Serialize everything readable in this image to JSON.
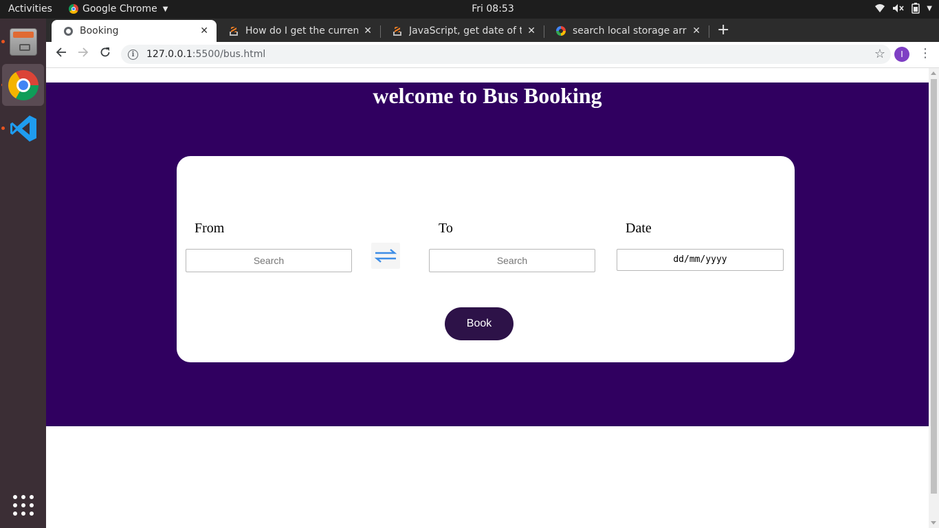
{
  "system": {
    "activities_label": "Activities",
    "app_menu_label": "Google Chrome",
    "clock": "Fri 08:53"
  },
  "dock": {
    "items": [
      "files-icon",
      "chrome-icon",
      "vscode-icon",
      "app-grid-icon"
    ]
  },
  "browser": {
    "tabs": [
      {
        "title": "Booking",
        "favicon": "globe-icon",
        "active": true
      },
      {
        "title": "How do I get the current d",
        "favicon": "stackoverflow-icon",
        "active": false
      },
      {
        "title": "JavaScript, get date of the",
        "favicon": "stackoverflow-icon",
        "active": false
      },
      {
        "title": "search local storage array",
        "favicon": "google-icon",
        "active": false
      }
    ],
    "new_tab_label": "+",
    "url_host": "127.0.0.1",
    "url_path": ":5500/bus.html",
    "profile_initial": "I"
  },
  "page": {
    "title": "welcome to Bus Booking",
    "from_label": "From",
    "to_label": "To",
    "date_label": "Date",
    "from_placeholder": "Search",
    "to_placeholder": "Search",
    "date_value": "dd/mm/yyyy",
    "book_label": "Book",
    "colors": {
      "hero_background": "#300060",
      "book_button": "#2d1248",
      "swap_icon": "#3d8de6"
    }
  }
}
